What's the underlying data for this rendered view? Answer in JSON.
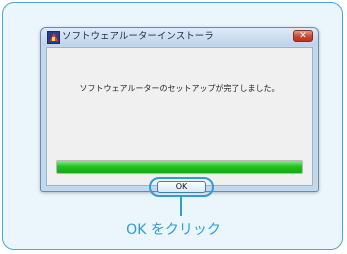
{
  "dialog": {
    "title": "ソフトウェアルーターインストーラ",
    "close_label": "✕",
    "message": "ソフトウェアルーターのセットアップが完了しました。",
    "progress": 1.0,
    "ok_label": "OK"
  },
  "annotation": {
    "callout": "OK をクリック"
  },
  "colors": {
    "frame_border": "#4aa6dc",
    "frame_background": "#eaf5fc",
    "callout": "#2f9bd7",
    "progress_fill": "#22c322",
    "close_button": "#c8472f"
  },
  "icons": {
    "app": "installer-app-icon",
    "close": "close-icon"
  }
}
